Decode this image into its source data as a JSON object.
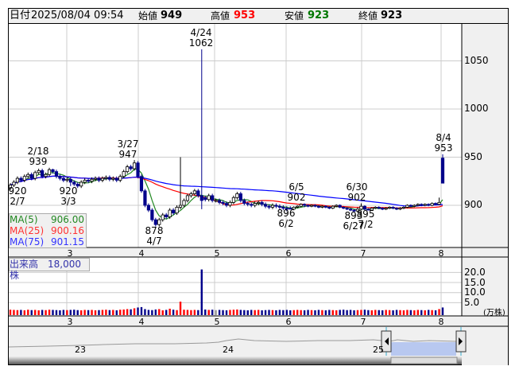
{
  "header": {
    "date_label": "日付",
    "date": "2025/08/04 09:54",
    "open_label": "始値",
    "open": "949",
    "high_label": "高値",
    "high": "953",
    "low_label": "安値",
    "low": "923",
    "close_label": "終値",
    "close": "923"
  },
  "colors": {
    "up": "#ffffff",
    "down": "#00008b",
    "ma5": "#228822",
    "ma25": "#ff0000",
    "ma75": "#0000ff",
    "vol_up": "#ff0000",
    "vol_down": "#00008b",
    "vol_flat": "#999999",
    "high_value": "#ff0000",
    "low_value": "#007700"
  },
  "legend": {
    "ma5_label": "MA(5)",
    "ma5": "906.00",
    "ma25_label": "MA(25)",
    "ma25": "900.16",
    "ma75_label": "MA(75)",
    "ma75": "901.15"
  },
  "volume_panel": {
    "label": "出来高　18,000株",
    "unit": "(万株)",
    "ticks": [
      "20.0",
      "15.0",
      "10.0",
      "5.0"
    ]
  },
  "navigator": {
    "labels": [
      "23",
      "24",
      "25"
    ]
  },
  "chart_data": {
    "type": "candlestick",
    "price_ticks": [
      "1050",
      "1000",
      "950",
      "900"
    ],
    "month_ticks": [
      "3",
      "4",
      "5",
      "6",
      "7",
      "8"
    ],
    "annotations": [
      {
        "date": "2/18",
        "value": "939"
      },
      {
        "date": "2/7",
        "value": "920"
      },
      {
        "date": "3/3",
        "value": "920"
      },
      {
        "date": "3/27",
        "value": "947"
      },
      {
        "date": "4/7",
        "value": "878"
      },
      {
        "date": "4/24",
        "value": "1062"
      },
      {
        "date": "6/5",
        "value": "902"
      },
      {
        "date": "6/2",
        "value": "896"
      },
      {
        "date": "6/30",
        "value": "902"
      },
      {
        "date": "6/27",
        "value": "893"
      },
      {
        "date": "7/2",
        "value": "895"
      },
      {
        "date": "8/4",
        "value": "953"
      }
    ],
    "candles": [
      [
        918,
        923,
        916,
        921
      ],
      [
        921,
        926,
        919,
        924
      ],
      [
        924,
        930,
        922,
        928
      ],
      [
        928,
        930,
        924,
        926
      ],
      [
        926,
        932,
        924,
        930
      ],
      [
        930,
        934,
        928,
        932
      ],
      [
        932,
        934,
        926,
        928
      ],
      [
        928,
        936,
        926,
        934
      ],
      [
        934,
        938,
        932,
        936
      ],
      [
        936,
        938,
        928,
        930
      ],
      [
        930,
        934,
        928,
        932
      ],
      [
        932,
        939,
        930,
        937
      ],
      [
        937,
        938,
        933,
        935
      ],
      [
        935,
        937,
        928,
        930
      ],
      [
        930,
        932,
        926,
        928
      ],
      [
        928,
        930,
        924,
        926
      ],
      [
        926,
        929,
        924,
        927
      ],
      [
        927,
        929,
        920,
        924
      ],
      [
        924,
        926,
        920,
        922
      ],
      [
        922,
        924,
        918,
        920
      ],
      [
        920,
        926,
        918,
        924
      ],
      [
        924,
        928,
        922,
        926
      ],
      [
        926,
        928,
        923,
        925
      ],
      [
        925,
        929,
        923,
        927
      ],
      [
        927,
        930,
        925,
        928
      ],
      [
        928,
        930,
        924,
        926
      ],
      [
        926,
        930,
        924,
        928
      ],
      [
        928,
        931,
        926,
        929
      ],
      [
        929,
        931,
        925,
        927
      ],
      [
        927,
        930,
        925,
        928
      ],
      [
        928,
        930,
        924,
        926
      ],
      [
        926,
        932,
        924,
        930
      ],
      [
        930,
        937,
        928,
        935
      ],
      [
        935,
        942,
        933,
        940
      ],
      [
        940,
        942,
        936,
        938
      ],
      [
        938,
        947,
        936,
        944
      ],
      [
        944,
        946,
        928,
        930
      ],
      [
        930,
        932,
        913,
        915
      ],
      [
        915,
        917,
        898,
        900
      ],
      [
        900,
        902,
        893,
        895
      ],
      [
        895,
        897,
        883,
        885
      ],
      [
        885,
        887,
        878,
        880
      ],
      [
        880,
        887,
        878,
        885
      ],
      [
        885,
        892,
        883,
        890
      ],
      [
        890,
        892,
        886,
        888
      ],
      [
        888,
        897,
        886,
        895
      ],
      [
        895,
        897,
        890,
        892
      ],
      [
        892,
        900,
        890,
        898
      ],
      [
        898,
        950,
        896,
        900
      ],
      [
        900,
        907,
        898,
        905
      ],
      [
        905,
        912,
        903,
        910
      ],
      [
        910,
        914,
        908,
        912
      ],
      [
        912,
        917,
        910,
        915
      ],
      [
        915,
        917,
        908,
        910
      ],
      [
        910,
        1062,
        896,
        905
      ],
      [
        908,
        910,
        904,
        906
      ],
      [
        906,
        912,
        904,
        910
      ],
      [
        910,
        912,
        903,
        905
      ],
      [
        905,
        907,
        903,
        905
      ],
      [
        905,
        907,
        901,
        903
      ],
      [
        903,
        905,
        900,
        902
      ],
      [
        902,
        904,
        898,
        900
      ],
      [
        900,
        905,
        898,
        903
      ],
      [
        903,
        910,
        901,
        908
      ],
      [
        908,
        914,
        906,
        912
      ],
      [
        912,
        914,
        903,
        905
      ],
      [
        905,
        907,
        900,
        902
      ],
      [
        902,
        904,
        899,
        901
      ],
      [
        901,
        903,
        898,
        900
      ],
      [
        900,
        904,
        898,
        902
      ],
      [
        902,
        905,
        900,
        903
      ],
      [
        903,
        905,
        899,
        901
      ],
      [
        901,
        903,
        897,
        899
      ],
      [
        899,
        901,
        896,
        898
      ],
      [
        898,
        902,
        896,
        900
      ],
      [
        900,
        902,
        897,
        899
      ],
      [
        899,
        901,
        896,
        898
      ],
      [
        898,
        900,
        895,
        897
      ],
      [
        897,
        899,
        894,
        896
      ],
      [
        897,
        899,
        896,
        896
      ],
      [
        896,
        899,
        896,
        898
      ],
      [
        898,
        900,
        897,
        899
      ],
      [
        899,
        902,
        898,
        901
      ],
      [
        901,
        902,
        898,
        900
      ],
      [
        900,
        901,
        898,
        899
      ],
      [
        899,
        901,
        898,
        900
      ],
      [
        900,
        901,
        898,
        899
      ],
      [
        899,
        900,
        897,
        898
      ],
      [
        898,
        900,
        897,
        899
      ],
      [
        899,
        900,
        897,
        898
      ],
      [
        898,
        899,
        896,
        897
      ],
      [
        897,
        900,
        896,
        899
      ],
      [
        899,
        901,
        898,
        900
      ],
      [
        900,
        901,
        897,
        898
      ],
      [
        898,
        899,
        896,
        897
      ],
      [
        897,
        898,
        895,
        896
      ],
      [
        896,
        897,
        894,
        895
      ],
      [
        895,
        896,
        893,
        894
      ],
      [
        894,
        898,
        893,
        896
      ],
      [
        896,
        902,
        895,
        899
      ],
      [
        899,
        900,
        895,
        896
      ],
      [
        896,
        897,
        895,
        895
      ],
      [
        895,
        898,
        895,
        897
      ],
      [
        897,
        899,
        896,
        898
      ],
      [
        898,
        899,
        896,
        897
      ],
      [
        897,
        898,
        895,
        896
      ],
      [
        896,
        898,
        895,
        897
      ],
      [
        897,
        899,
        896,
        898
      ],
      [
        898,
        899,
        896,
        897
      ],
      [
        897,
        898,
        895,
        896
      ],
      [
        896,
        898,
        895,
        897
      ],
      [
        897,
        899,
        896,
        898
      ],
      [
        898,
        901,
        897,
        900
      ],
      [
        900,
        901,
        898,
        899
      ],
      [
        899,
        901,
        898,
        900
      ],
      [
        900,
        902,
        899,
        901
      ],
      [
        901,
        902,
        899,
        900
      ],
      [
        900,
        902,
        899,
        901
      ],
      [
        901,
        902,
        899,
        900
      ],
      [
        900,
        903,
        899,
        902
      ],
      [
        902,
        903,
        900,
        901
      ],
      [
        901,
        908,
        900,
        903
      ],
      [
        949,
        953,
        923,
        923
      ]
    ],
    "volume": [
      1.5,
      1.4,
      1.3,
      1.4,
      1.2,
      1.5,
      1.3,
      1.4,
      1.2,
      1.4,
      1.3,
      1.5,
      1.4,
      1.3,
      1.2,
      1.4,
      1.3,
      1.4,
      1.5,
      1.3,
      1.2,
      1.4,
      1.3,
      1.4,
      1.2,
      1.3,
      1.4,
      1.5,
      1.3,
      1.4,
      1.2,
      1.5,
      1.6,
      1.8,
      1.7,
      2.2,
      2.6,
      2.8,
      1.8,
      1.4,
      1.3,
      1.6,
      1.8,
      1.2,
      1.4,
      2.0,
      1.5,
      1.3,
      5.5,
      1.5,
      1.4,
      1.3,
      1.4,
      1.3,
      21.5,
      1.6,
      1.4,
      1.5,
      1.3,
      1.4,
      1.3,
      1.2,
      1.4,
      1.5,
      1.6,
      1.4,
      1.3,
      1.2,
      1.4,
      1.3,
      1.4,
      1.2,
      1.3,
      1.4,
      1.3,
      1.2,
      1.4,
      1.3,
      1.4,
      1.2,
      1.3,
      1.4,
      1.3,
      1.2,
      1.4,
      1.3,
      1.2,
      1.4,
      1.3,
      1.2,
      1.4,
      1.3,
      1.2,
      1.4,
      1.5,
      1.3,
      1.4,
      1.2,
      1.3,
      1.4,
      1.5,
      1.3,
      1.2,
      1.4,
      1.3,
      1.2,
      1.4,
      1.3,
      1.2,
      1.4,
      1.3,
      1.2,
      1.4,
      1.3,
      1.2,
      1.4,
      1.3,
      1.2,
      1.4,
      1.3,
      1.2,
      1.8,
      2.6
    ]
  }
}
